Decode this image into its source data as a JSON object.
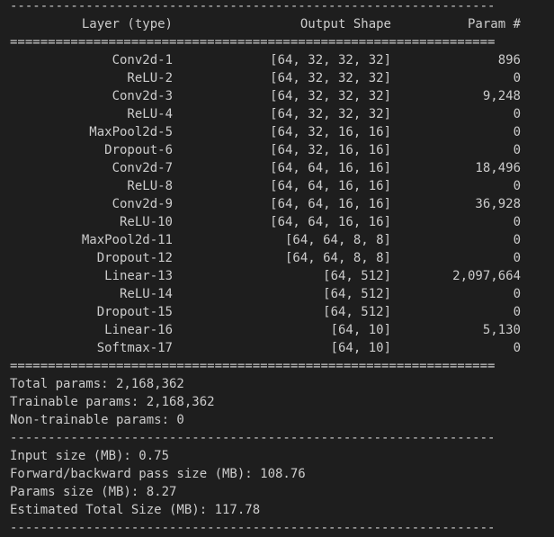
{
  "rules": {
    "dash": "----------------------------------------------------------------",
    "equals": "================================================================"
  },
  "header": {
    "layer": "Layer (type)",
    "shape": "Output Shape",
    "param": "Param #"
  },
  "rows": [
    {
      "layer": "Conv2d-1",
      "shape": "[64, 32, 32, 32]",
      "param": "896"
    },
    {
      "layer": "ReLU-2",
      "shape": "[64, 32, 32, 32]",
      "param": "0"
    },
    {
      "layer": "Conv2d-3",
      "shape": "[64, 32, 32, 32]",
      "param": "9,248"
    },
    {
      "layer": "ReLU-4",
      "shape": "[64, 32, 32, 32]",
      "param": "0"
    },
    {
      "layer": "MaxPool2d-5",
      "shape": "[64, 32, 16, 16]",
      "param": "0"
    },
    {
      "layer": "Dropout-6",
      "shape": "[64, 32, 16, 16]",
      "param": "0"
    },
    {
      "layer": "Conv2d-7",
      "shape": "[64, 64, 16, 16]",
      "param": "18,496"
    },
    {
      "layer": "ReLU-8",
      "shape": "[64, 64, 16, 16]",
      "param": "0"
    },
    {
      "layer": "Conv2d-9",
      "shape": "[64, 64, 16, 16]",
      "param": "36,928"
    },
    {
      "layer": "ReLU-10",
      "shape": "[64, 64, 16, 16]",
      "param": "0"
    },
    {
      "layer": "MaxPool2d-11",
      "shape": "[64, 64, 8, 8]",
      "param": "0"
    },
    {
      "layer": "Dropout-12",
      "shape": "[64, 64, 8, 8]",
      "param": "0"
    },
    {
      "layer": "Linear-13",
      "shape": "[64, 512]",
      "param": "2,097,664"
    },
    {
      "layer": "ReLU-14",
      "shape": "[64, 512]",
      "param": "0"
    },
    {
      "layer": "Dropout-15",
      "shape": "[64, 512]",
      "param": "0"
    },
    {
      "layer": "Linear-16",
      "shape": "[64, 10]",
      "param": "5,130"
    },
    {
      "layer": "Softmax-17",
      "shape": "[64, 10]",
      "param": "0"
    }
  ],
  "params": {
    "total": "Total params: 2,168,362",
    "trainable": "Trainable params: 2,168,362",
    "non_trainable": "Non-trainable params: 0"
  },
  "sizes": {
    "input": "Input size (MB): 0.75",
    "forward_backward": "Forward/backward pass size (MB): 108.76",
    "params": "Params size (MB): 8.27",
    "total": "Estimated Total Size (MB): 117.78"
  }
}
